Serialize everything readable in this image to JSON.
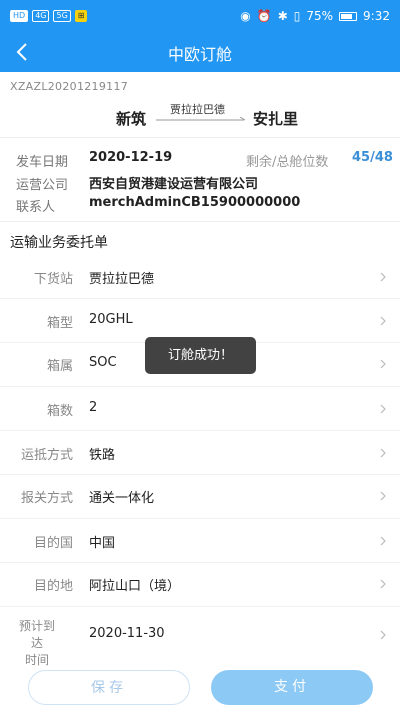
{
  "status_bar": {
    "left_chips": [
      "HD",
      "4G",
      "5G",
      "⊞"
    ],
    "battery_percent": "75%",
    "time": "9:32"
  },
  "nav": {
    "title": "中欧订舱"
  },
  "order": {
    "number": "XZAZL20201219117",
    "route": {
      "from": "新筑",
      "via": "贾拉拉巴德",
      "to": "安扎里"
    },
    "departure_label": "发车日期",
    "departure_date": "2020-12-19",
    "remaining_label": "剩余/总舱位数",
    "remaining_value": "45/48",
    "operator_label": "运营公司",
    "operator": "西安自贸港建设运营有限公司",
    "contact_label": "联系人",
    "contact": "merchAdminCB15900000000"
  },
  "section_title": "运输业务委托单",
  "form_rows": [
    {
      "label": "下货站",
      "value": "贾拉拉巴德"
    },
    {
      "label": "箱型",
      "value": "20GHL"
    },
    {
      "label": "箱属",
      "value": "SOC"
    },
    {
      "label": "箱数",
      "value": "2"
    },
    {
      "label": "运抵方式",
      "value": "铁路"
    },
    {
      "label": "报关方式",
      "value": "通关一体化"
    },
    {
      "label": "目的国",
      "value": "中国"
    },
    {
      "label": "目的地",
      "value": "阿拉山口（境）"
    },
    {
      "label": "预计到达时间",
      "label_line1": "预计到达",
      "label_line2": "时间",
      "value": "2020-11-30"
    }
  ],
  "toast": "订舱成功！",
  "buttons": {
    "save": "保存",
    "pay": "支付"
  }
}
